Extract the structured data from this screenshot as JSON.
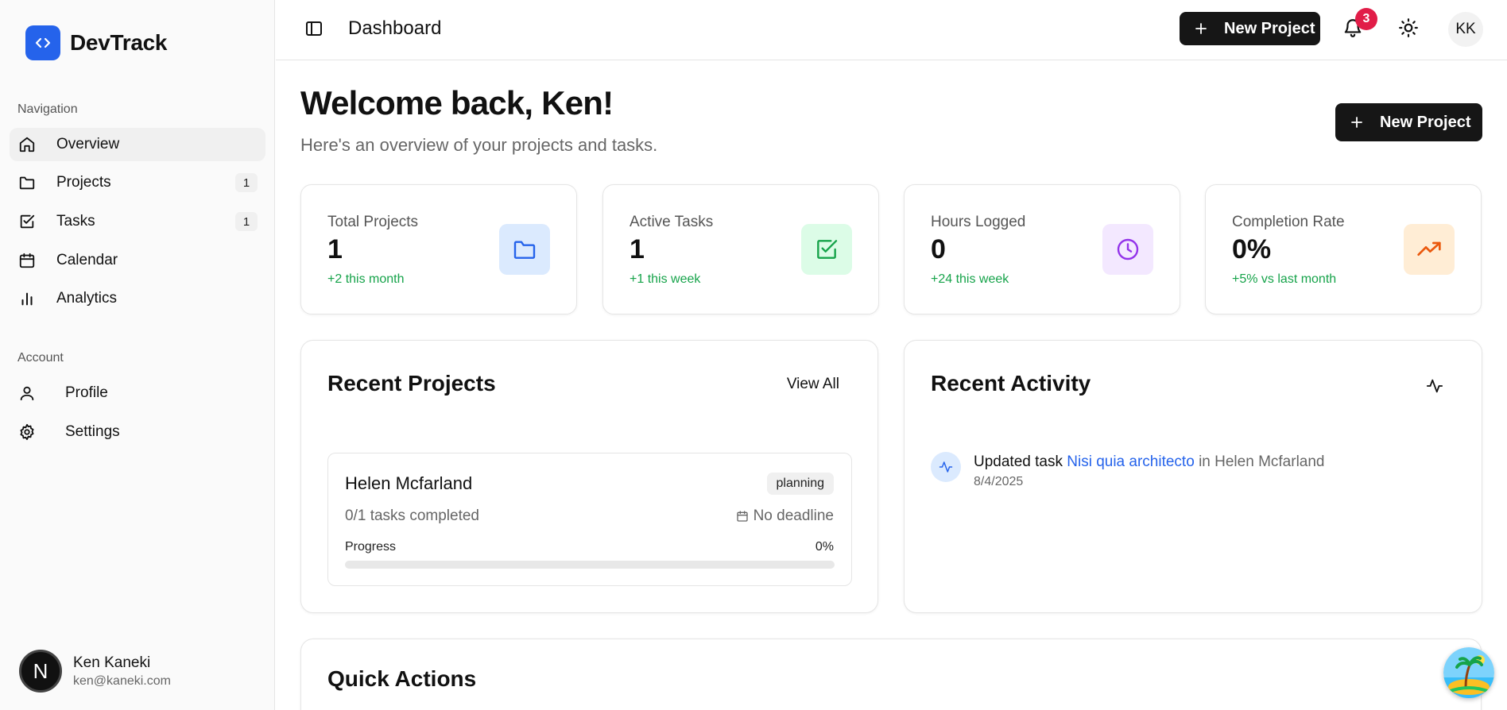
{
  "brand": {
    "name": "DevTrack"
  },
  "sidebar": {
    "nav_label": "Navigation",
    "nav_items": [
      {
        "label": "Overview",
        "icon": "home-icon",
        "active": true
      },
      {
        "label": "Projects",
        "icon": "folder-icon",
        "badge": "1"
      },
      {
        "label": "Tasks",
        "icon": "check-square-icon",
        "badge": "1"
      },
      {
        "label": "Calendar",
        "icon": "calendar-icon"
      },
      {
        "label": "Analytics",
        "icon": "bar-chart-icon"
      }
    ],
    "account_label": "Account",
    "account_items": [
      {
        "label": "Profile",
        "icon": "user-icon"
      },
      {
        "label": "Settings",
        "icon": "gear-icon"
      }
    ],
    "user": {
      "initial": "N",
      "name": "Ken Kaneki",
      "email": "ken@kaneki.com"
    }
  },
  "header": {
    "title": "Dashboard",
    "new_project_label": "New Project",
    "notification_count": "3",
    "avatar_initials": "KK"
  },
  "main": {
    "welcome": "Welcome back, Ken!",
    "subtitle": "Here's an overview of your projects and tasks.",
    "new_project_label": "New Project",
    "stats": [
      {
        "label": "Total Projects",
        "value": "1",
        "change": "+2 this month",
        "icon": "folder-icon",
        "icon_bg": "#dbeafe",
        "icon_color": "#2563eb"
      },
      {
        "label": "Active Tasks",
        "value": "1",
        "change": "+1 this week",
        "icon": "check-square-icon",
        "icon_bg": "#dcfce7",
        "icon_color": "#16a34a"
      },
      {
        "label": "Hours Logged",
        "value": "0",
        "change": "+24 this week",
        "icon": "clock-icon",
        "icon_bg": "#f3e8ff",
        "icon_color": "#9333ea"
      },
      {
        "label": "Completion Rate",
        "value": "0%",
        "change": "+5% vs last month",
        "icon": "trending-up-icon",
        "icon_bg": "#ffedd5",
        "icon_color": "#ea580c"
      }
    ],
    "recent_projects": {
      "title": "Recent Projects",
      "view_all_label": "View All",
      "project": {
        "name": "Helen Mcfarland",
        "status": "planning",
        "tasks_completed": "0/1 tasks completed",
        "deadline": "No deadline",
        "progress_label": "Progress",
        "progress_percent": "0%",
        "progress_value": 0
      }
    },
    "recent_activity": {
      "title": "Recent Activity",
      "item": {
        "prefix": "Updated task",
        "task_link": "Nisi quia architecto",
        "in_text": "in",
        "project": "Helen Mcfarland",
        "date": "8/4/2025"
      }
    },
    "quick_actions": {
      "title": "Quick Actions"
    }
  },
  "colors": {
    "accent": "#2563eb",
    "positive": "#16a34a",
    "badge_red": "#e11d48",
    "dark_button": "#161616"
  }
}
